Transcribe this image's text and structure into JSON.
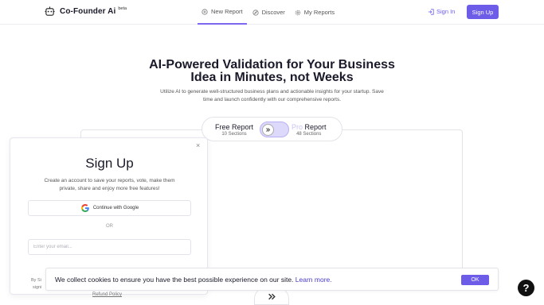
{
  "nav": {
    "brand": "Co-Founder Ai",
    "beta": "beta",
    "links": [
      {
        "label": "New Report",
        "icon": "plus-circle-icon"
      },
      {
        "label": "Discover",
        "icon": "compass-icon"
      },
      {
        "label": "My Reports",
        "icon": "gear-icon"
      }
    ],
    "signin": "Sign In",
    "signup": "Sign Up"
  },
  "hero": {
    "title_line1": "AI-Powered Validation for Your Business",
    "title_line2": "Idea in Minutes, not Weeks",
    "subtitle_line1": "Utilize AI to generate well-structured business plans and actionable insights for your startup. Save",
    "subtitle_line2": "time and launch confidently with our comprehensive reports."
  },
  "toggle": {
    "free_label": "Free Report",
    "free_sections": "10 Sections",
    "pro_prefix": "Pro",
    "pro_label": " Report",
    "pro_sections": "48 Sections"
  },
  "modal": {
    "close": "×",
    "title": "Sign Up",
    "desc_line1": "Create an account to save your reports, vote, make them",
    "desc_line2": "private, share and enjoy more free features!",
    "google_button": "Continue with Google",
    "or": "OR",
    "email_placeholder": "Enter your email...",
    "by_text": "By Si",
    "sig_text": "signi",
    "refund": "Refund Policy"
  },
  "cookie": {
    "text": "We collect cookies to ensure you have the best possible experience on our site.",
    "link": "Learn more.",
    "ok": "OK"
  },
  "help": "?",
  "colors": {
    "accent": "#6d5ce8",
    "link": "#4a3cc9"
  }
}
